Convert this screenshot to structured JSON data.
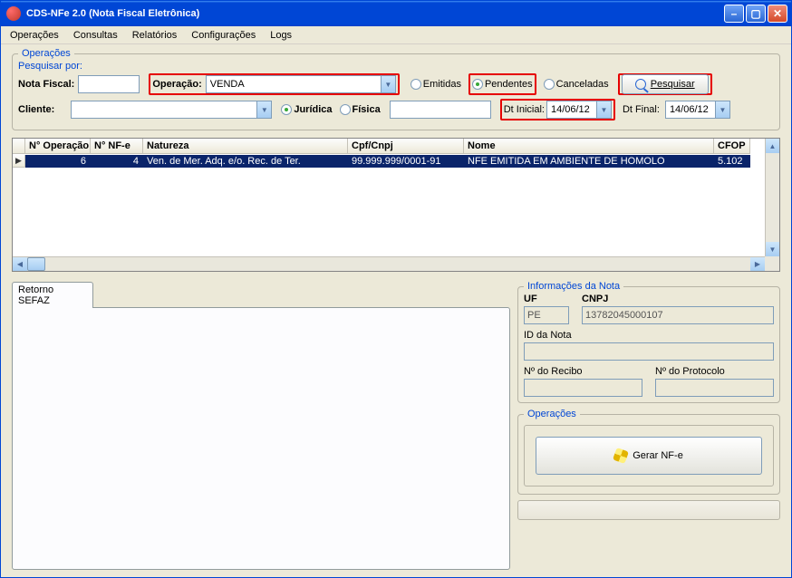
{
  "window": {
    "title": "CDS-NFe 2.0 (Nota Fiscal Eletrônica)"
  },
  "menu": {
    "items": [
      "Operações",
      "Consultas",
      "Relatórios",
      "Configurações",
      "Logs"
    ]
  },
  "search": {
    "group_label": "Operações",
    "subgroup_label": "Pesquisar por:",
    "nota_fiscal_label": "Nota Fiscal:",
    "nota_fiscal_value": "",
    "operacao_label": "Operação:",
    "operacao_value": "VENDA",
    "status": {
      "emitidas": "Emitidas",
      "pendentes": "Pendentes",
      "canceladas": "Canceladas",
      "selected": "pendentes"
    },
    "pesquisar_btn": "Pesquisar",
    "cliente_label": "Cliente:",
    "cliente_value": "",
    "tipo_juridica": "Jurídica",
    "tipo_fisica": "Física",
    "tipo_selected": "juridica",
    "blank_field": "",
    "dt_inicial_label": "Dt Inicial:",
    "dt_inicial_value": "14/06/12",
    "dt_final_label": "Dt Final:",
    "dt_final_value": "14/06/12"
  },
  "grid": {
    "headers": {
      "n_operacao": "N° Operação",
      "n_nfe": "N° NF-e",
      "natureza": "Natureza",
      "cpf_cnpj": "Cpf/Cnpj",
      "nome": "Nome",
      "cfop": "CFOP"
    },
    "rows": [
      {
        "n_operacao": "6",
        "n_nfe": "4",
        "natureza": "Ven. de Mer. Adq. e/o. Rec. de Ter.",
        "cpf_cnpj": "99.999.999/0001-91",
        "nome": "NFE EMITIDA EM AMBIENTE DE HOMOLO",
        "cfop": "5.102"
      }
    ]
  },
  "tab": {
    "label": "Retorno SEFAZ"
  },
  "info": {
    "group_label": "Informações da Nota",
    "uf_label": "UF",
    "uf_value": "PE",
    "cnpj_label": "CNPJ",
    "cnpj_value": "13782045000107",
    "id_nota_label": "ID da Nota",
    "id_nota_value": "",
    "recibo_label": "Nº do Recibo",
    "recibo_value": "",
    "protocolo_label": "Nº do Protocolo",
    "protocolo_value": ""
  },
  "operacoes_box": {
    "group_label": "Operações",
    "gerar_btn": "Gerar NF-e"
  }
}
